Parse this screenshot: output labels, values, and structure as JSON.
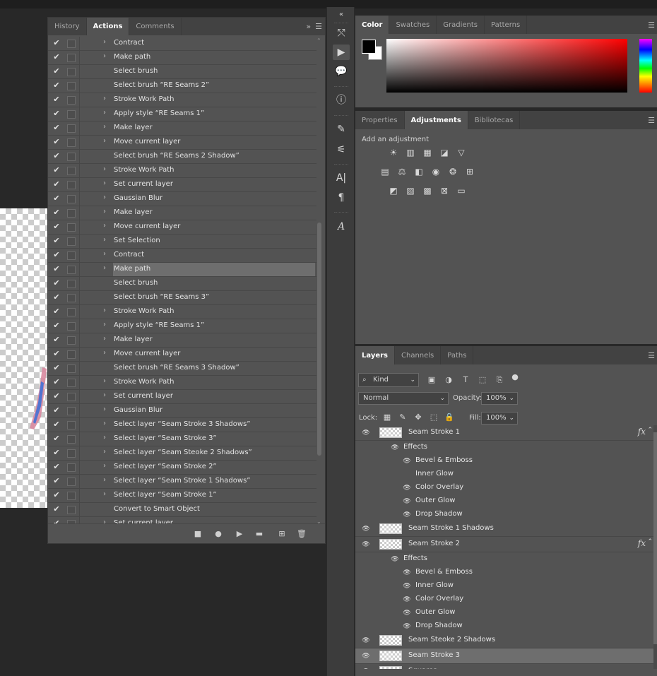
{
  "actions_panel": {
    "tabs": [
      {
        "label": "History",
        "active": false
      },
      {
        "label": "Actions",
        "active": true
      },
      {
        "label": "Comments",
        "active": false
      }
    ],
    "expand_icon": "double-chevron-right-icon",
    "menu_icon": "hamburger-menu-icon",
    "rows": [
      {
        "label": "Contract",
        "expandable": true,
        "checked": true,
        "selected": false
      },
      {
        "label": "Make path",
        "expandable": true,
        "checked": true,
        "selected": false
      },
      {
        "label": "Select brush",
        "expandable": false,
        "checked": true,
        "selected": false
      },
      {
        "label": "Select brush “RE Seams 2”",
        "expandable": false,
        "checked": true,
        "selected": false
      },
      {
        "label": "Stroke Work Path",
        "expandable": true,
        "checked": true,
        "selected": false
      },
      {
        "label": "Apply style “RE Seams 1”",
        "expandable": true,
        "checked": true,
        "selected": false
      },
      {
        "label": "Make layer",
        "expandable": true,
        "checked": true,
        "selected": false
      },
      {
        "label": "Move current layer",
        "expandable": true,
        "checked": true,
        "selected": false
      },
      {
        "label": "Select brush “RE Seams 2 Shadow”",
        "expandable": false,
        "checked": true,
        "selected": false
      },
      {
        "label": "Stroke Work Path",
        "expandable": true,
        "checked": true,
        "selected": false
      },
      {
        "label": "Set current layer",
        "expandable": true,
        "checked": true,
        "selected": false
      },
      {
        "label": "Gaussian Blur",
        "expandable": true,
        "checked": true,
        "selected": false
      },
      {
        "label": "Make layer",
        "expandable": true,
        "checked": true,
        "selected": false
      },
      {
        "label": "Move current layer",
        "expandable": true,
        "checked": true,
        "selected": false
      },
      {
        "label": "Set Selection",
        "expandable": true,
        "checked": true,
        "selected": false
      },
      {
        "label": "Contract",
        "expandable": true,
        "checked": true,
        "selected": false
      },
      {
        "label": "Make path",
        "expandable": true,
        "checked": true,
        "selected": true
      },
      {
        "label": "Select brush",
        "expandable": false,
        "checked": true,
        "selected": false
      },
      {
        "label": "Select brush “RE Seams 3”",
        "expandable": false,
        "checked": true,
        "selected": false
      },
      {
        "label": "Stroke Work Path",
        "expandable": true,
        "checked": true,
        "selected": false
      },
      {
        "label": "Apply style “RE Seams 1”",
        "expandable": true,
        "checked": true,
        "selected": false
      },
      {
        "label": "Make layer",
        "expandable": true,
        "checked": true,
        "selected": false
      },
      {
        "label": "Move current layer",
        "expandable": true,
        "checked": true,
        "selected": false
      },
      {
        "label": "Select brush “RE Seams 3 Shadow”",
        "expandable": false,
        "checked": true,
        "selected": false
      },
      {
        "label": "Stroke Work Path",
        "expandable": true,
        "checked": true,
        "selected": false
      },
      {
        "label": "Set current layer",
        "expandable": true,
        "checked": true,
        "selected": false
      },
      {
        "label": "Gaussian Blur",
        "expandable": true,
        "checked": true,
        "selected": false
      },
      {
        "label": "Select layer “Seam Stroke 3 Shadows”",
        "expandable": true,
        "checked": true,
        "selected": false
      },
      {
        "label": "Select layer “Seam Stroke 3”",
        "expandable": true,
        "checked": true,
        "selected": false
      },
      {
        "label": "Select layer “Seam Steoke 2 Shadows”",
        "expandable": true,
        "checked": true,
        "selected": false
      },
      {
        "label": "Select layer “Seam Stroke 2”",
        "expandable": true,
        "checked": true,
        "selected": false
      },
      {
        "label": "Select layer “Seam Stroke 1 Shadows”",
        "expandable": true,
        "checked": true,
        "selected": false
      },
      {
        "label": "Select layer “Seam Stroke 1”",
        "expandable": true,
        "checked": true,
        "selected": false
      },
      {
        "label": "Convert to Smart Object",
        "expandable": false,
        "checked": true,
        "selected": false
      },
      {
        "label": "Set current layer",
        "expandable": true,
        "checked": true,
        "selected": false
      }
    ],
    "footer_icons": [
      "stop-icon",
      "record-icon",
      "play-icon",
      "new-set-folder-icon",
      "new-action-icon",
      "delete-icon"
    ]
  },
  "toolstrip": {
    "collapse_icon": "double-chevron-left-icon",
    "icons": [
      "properties-icon",
      "play-icon",
      "comment-icon",
      "info-icon",
      "brush-icon",
      "brush-settings-icon",
      "character-icon",
      "paragraph-icon",
      "glyphs-icon"
    ]
  },
  "color_panel": {
    "tabs": [
      {
        "label": "Color",
        "active": true
      },
      {
        "label": "Swatches",
        "active": false
      },
      {
        "label": "Gradients",
        "active": false
      },
      {
        "label": "Patterns",
        "active": false
      }
    ],
    "foreground": "#000000",
    "background": "#ffffff",
    "hue": "#ff0000"
  },
  "adjustments_panel": {
    "tabs": [
      {
        "label": "Properties",
        "active": false
      },
      {
        "label": "Adjustments",
        "active": true
      },
      {
        "label": "Bibliotecas",
        "active": false
      }
    ],
    "add_label": "Add an adjustment",
    "icons_row1": [
      "brightness-icon",
      "levels-icon",
      "curves-icon",
      "exposure-icon",
      "vibrance-icon"
    ],
    "icons_row2": [
      "hue-saturation-icon",
      "color-balance-icon",
      "black-white-icon",
      "photo-filter-icon",
      "channel-mixer-icon",
      "color-lookup-icon"
    ],
    "icons_row3": [
      "invert-icon",
      "posterize-icon",
      "threshold-icon",
      "selective-color-icon",
      "gradient-map-icon"
    ]
  },
  "layers_panel": {
    "tabs": [
      {
        "label": "Layers",
        "active": true
      },
      {
        "label": "Channels",
        "active": false
      },
      {
        "label": "Paths",
        "active": false
      }
    ],
    "filter_label": "Kind",
    "blend_mode": "Normal",
    "opacity_label": "Opacity:",
    "opacity_value": "100%",
    "lock_label": "Lock:",
    "fill_label": "Fill:",
    "fill_value": "100%",
    "fx_label": "fx",
    "rows": [
      {
        "type": "layer",
        "name": "Seam Stroke 1",
        "has_fx": true,
        "selected": false
      },
      {
        "type": "effects",
        "name": "Effects"
      },
      {
        "type": "effect",
        "name": "Bevel & Emboss",
        "visible": true
      },
      {
        "type": "effect",
        "name": "Inner Glow",
        "visible": false
      },
      {
        "type": "effect",
        "name": "Color Overlay",
        "visible": true
      },
      {
        "type": "effect",
        "name": "Outer Glow",
        "visible": true
      },
      {
        "type": "effect",
        "name": "Drop Shadow",
        "visible": true
      },
      {
        "type": "layer",
        "name": "Seam Stroke 1 Shadows",
        "has_fx": false,
        "selected": false
      },
      {
        "type": "layer",
        "name": "Seam Stroke 2",
        "has_fx": true,
        "selected": false
      },
      {
        "type": "effects",
        "name": "Effects"
      },
      {
        "type": "effect",
        "name": "Bevel & Emboss",
        "visible": true
      },
      {
        "type": "effect",
        "name": "Inner Glow",
        "visible": true
      },
      {
        "type": "effect",
        "name": "Color Overlay",
        "visible": true
      },
      {
        "type": "effect",
        "name": "Outer Glow",
        "visible": true
      },
      {
        "type": "effect",
        "name": "Drop Shadow",
        "visible": true
      },
      {
        "type": "layer",
        "name": "Seam Steoke 2 Shadows",
        "has_fx": false,
        "selected": false
      },
      {
        "type": "layer",
        "name": "Seam Stroke 3",
        "has_fx": false,
        "selected": true
      },
      {
        "type": "layer",
        "name": "Squares",
        "has_fx": false,
        "selected": false
      }
    ]
  }
}
